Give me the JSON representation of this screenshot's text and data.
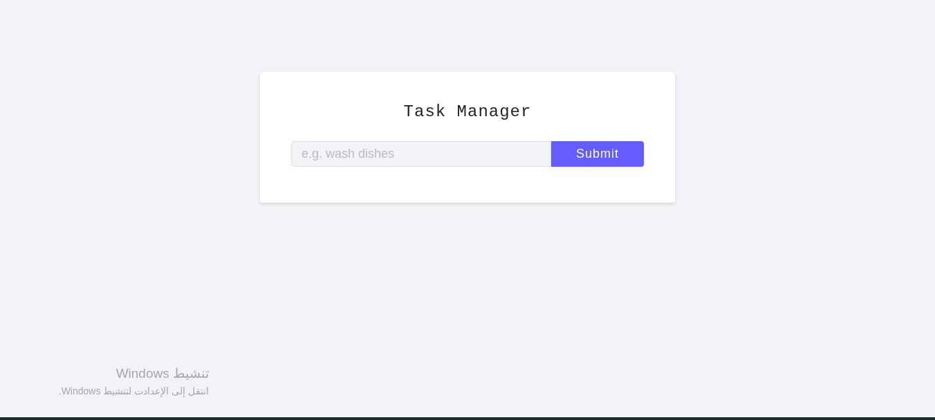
{
  "card": {
    "title": "Task Manager",
    "task_input": {
      "placeholder": "e.g. wash dishes"
    },
    "submit_button": "Submit"
  },
  "activation_notice": {
    "title": "تنشيط Windows",
    "message": "انتقل إلى الإعدادت لتنشيط Windows."
  }
}
